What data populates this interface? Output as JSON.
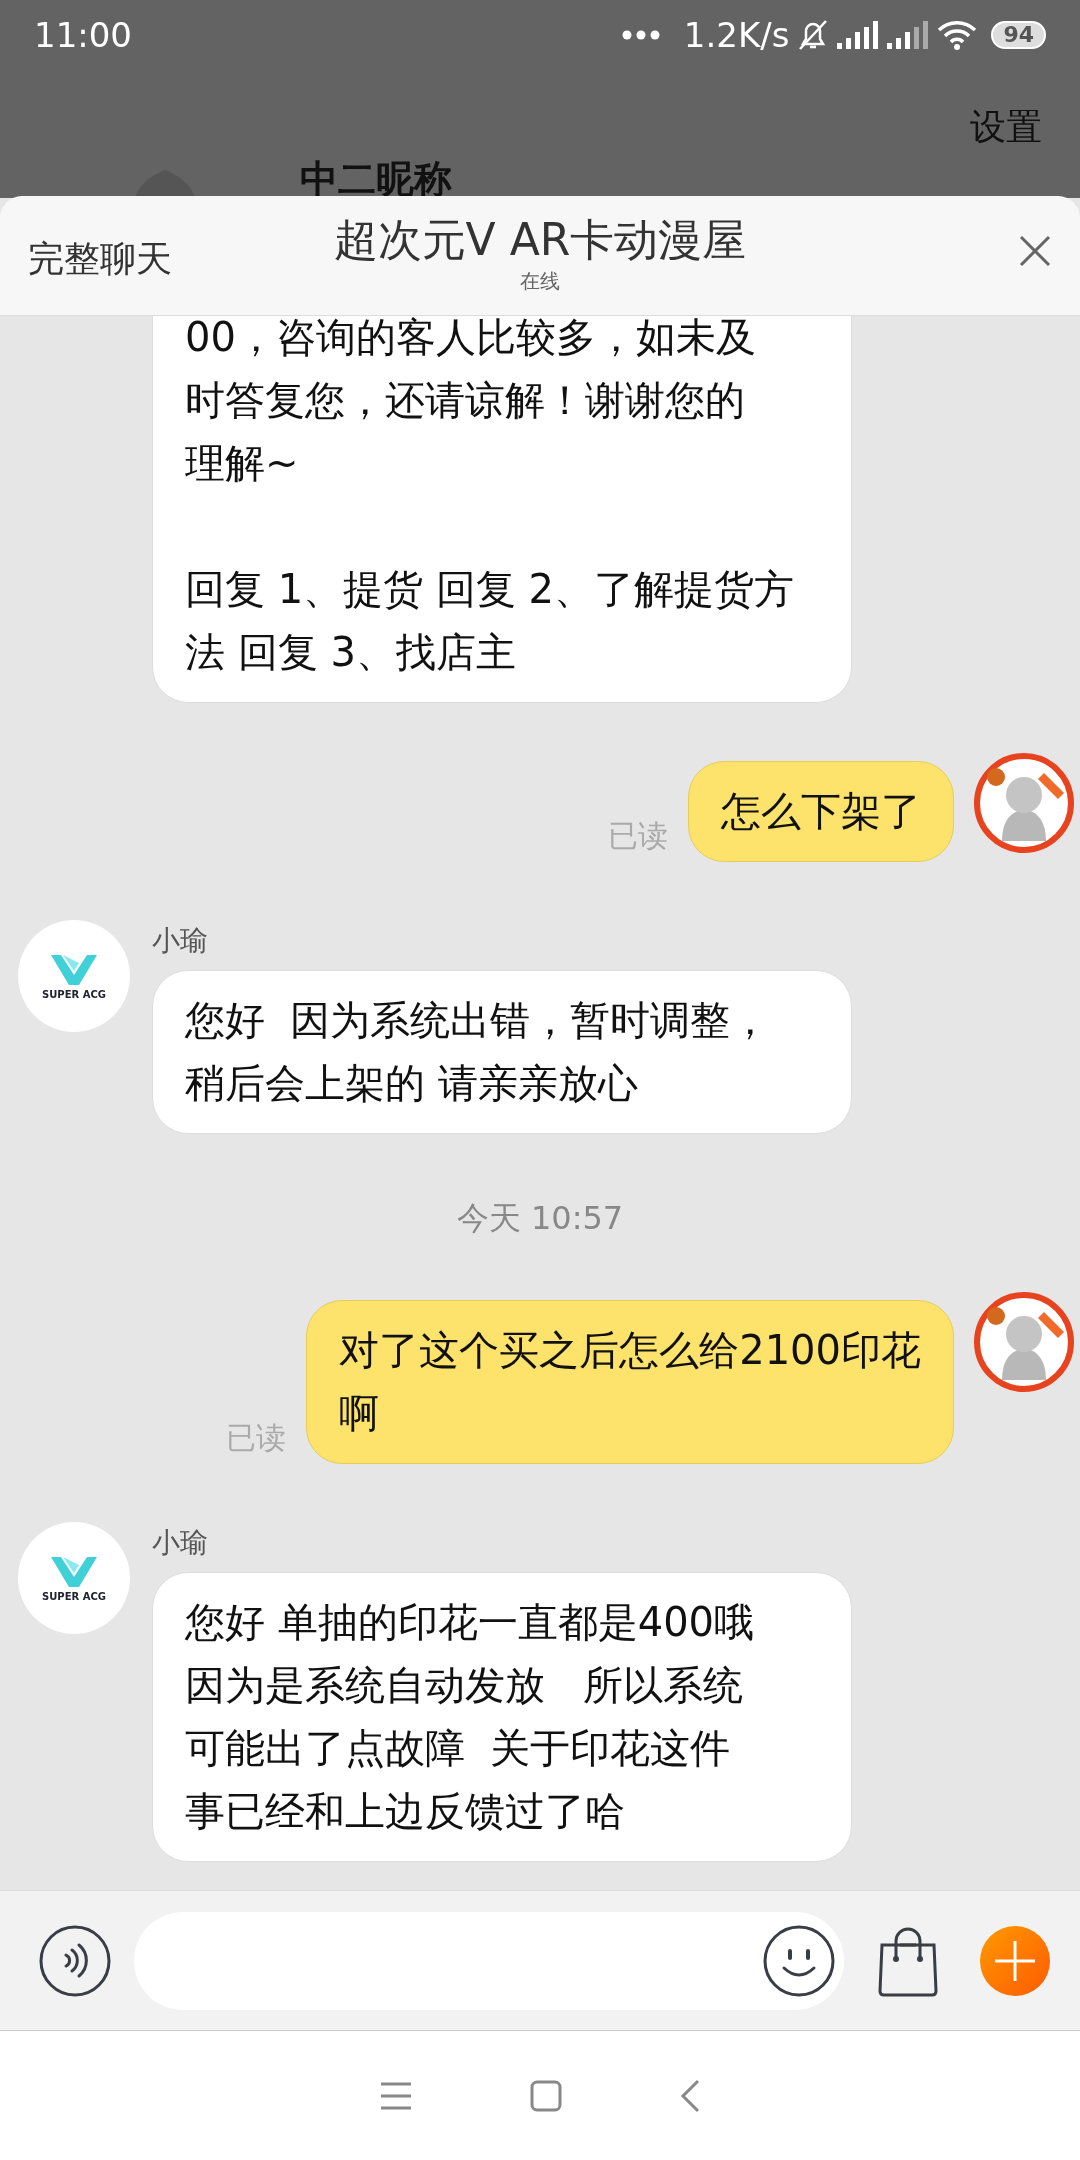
{
  "status_bar": {
    "time": "11:00",
    "speed": "1.2K/s",
    "battery": "94"
  },
  "background_page": {
    "settings": "设置",
    "nickname": "中二昵称"
  },
  "header": {
    "full_chat": "完整聊天",
    "title": "超次元V AR卡动漫屋",
    "status": "在线"
  },
  "messages": [
    {
      "kind": "incoming",
      "paragraphs": [
        [
          "00，咨询的客人比较多，如未及",
          "时答复您，还请谅解！谢谢您的",
          "理解~"
        ],
        [
          "回复 1、提货 回复 2、了解提货方",
          "法 回复 3、找店主"
        ]
      ]
    },
    {
      "kind": "outgoing",
      "paragraphs": [
        [
          "怎么下架了"
        ]
      ],
      "read": "已读"
    },
    {
      "kind": "incoming",
      "sender": "小瑜",
      "avatar_text": "SUPER ACG",
      "paragraphs": [
        [
          "您好  因为系统出错，暂时调整，",
          "稍后会上架的 请亲亲放心"
        ]
      ]
    },
    {
      "kind": "time",
      "text": "今天  10:57"
    },
    {
      "kind": "outgoing",
      "paragraphs": [
        [
          "对了这个买之后怎么给2100印花",
          "啊"
        ]
      ],
      "read": "已读"
    },
    {
      "kind": "incoming",
      "sender": "小瑜",
      "avatar_text": "SUPER ACG",
      "paragraphs": [
        [
          "您好 单抽的印花一直都是400哦",
          "因为是系统自动发放   所以系统",
          "可能出了点故障  关于印花这件",
          "事已经和上边反馈过了哈"
        ]
      ]
    }
  ]
}
